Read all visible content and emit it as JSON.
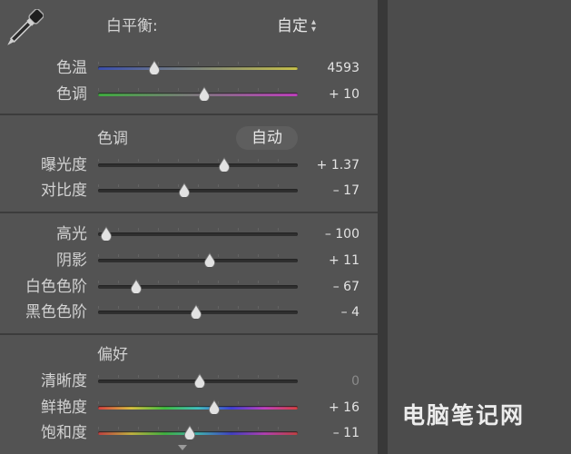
{
  "white_balance": {
    "title": "白平衡:",
    "preset": "自定",
    "preset_arrows": "▲▼",
    "eyedropper_icon": "eyedropper-icon"
  },
  "temp": {
    "label": "色温",
    "value": "4593",
    "position": 0.28
  },
  "tint": {
    "label": "色调",
    "value": "+ 10",
    "position": 0.53
  },
  "tone": {
    "title": "色调",
    "auto_label": "自动"
  },
  "exposure": {
    "label": "曝光度",
    "value": "+ 1.37",
    "position": 0.63
  },
  "contrast": {
    "label": "对比度",
    "value": "– 17",
    "position": 0.43
  },
  "highlights": {
    "label": "高光",
    "value": "– 100",
    "position": 0.04
  },
  "shadows": {
    "label": "阴影",
    "value": "+ 11",
    "position": 0.56
  },
  "whites": {
    "label": "白色色阶",
    "value": "– 67",
    "position": 0.19
  },
  "blacks": {
    "label": "黑色色阶",
    "value": "– 4",
    "position": 0.49
  },
  "presence": {
    "title": "偏好"
  },
  "clarity": {
    "label": "清晰度",
    "value": "0",
    "position": 0.51
  },
  "vibrance": {
    "label": "鲜艳度",
    "value": "+ 16",
    "position": 0.58
  },
  "saturation": {
    "label": "饱和度",
    "value": "– 11",
    "position": 0.46
  },
  "watermark": "电脑笔记网",
  "colors": {
    "panel": "#535353",
    "temp_gradient": [
      "#3a4fb0",
      "#c9c34a"
    ],
    "tint_gradient": [
      "#3fae3f",
      "#c03fbf"
    ],
    "vibrance_gradient": [
      "#d84040",
      "#d8c040",
      "#40c040",
      "#40c0c0",
      "#4040d8",
      "#c040c0",
      "#d84040"
    ],
    "saturation_gradient": [
      "#c04040",
      "#c0b040",
      "#40b040",
      "#40b0b0",
      "#4040c0",
      "#b040b0",
      "#c04040"
    ]
  }
}
